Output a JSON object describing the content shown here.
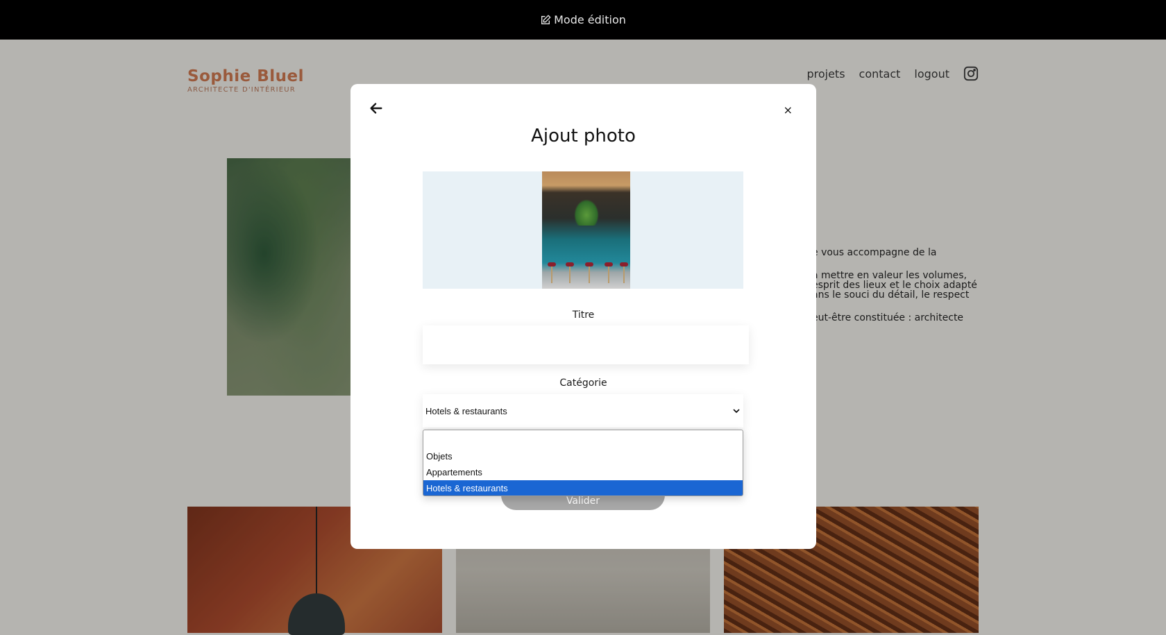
{
  "edit_bar": {
    "label": "Mode édition",
    "icon": "edit-icon"
  },
  "header": {
    "logo_name": "Sophie Bluel",
    "logo_subtitle": "ARCHITECTE D'INTÉRIEUR",
    "nav": [
      "projets",
      "contact",
      "logout"
    ],
    "instagram_icon": "instagram-icon"
  },
  "intro": {
    "lines": [
      "e vous accompagne de la",
      "à mettre en valeur les volumes,\nesprit des lieux et le choix adapté\nans le souci du détail, le respect",
      "eut-être constituée : architecte"
    ]
  },
  "modal": {
    "back_icon": "arrow-left-icon",
    "close_label": "×",
    "title": "Ajout photo",
    "title_label": "Titre",
    "title_value": "",
    "category_label": "Catégorie",
    "category_selected": "Hotels & restaurants",
    "category_options": [
      "",
      "Objets",
      "Appartements",
      "Hotels & restaurants"
    ],
    "submit_label": "Valider"
  },
  "colors": {
    "topbar": "#000000",
    "brand": "#9a5a3c",
    "upload_bg": "#e8f1f6",
    "selected_option": "#1a66d3",
    "submit_disabled": "#a7a7a7"
  }
}
